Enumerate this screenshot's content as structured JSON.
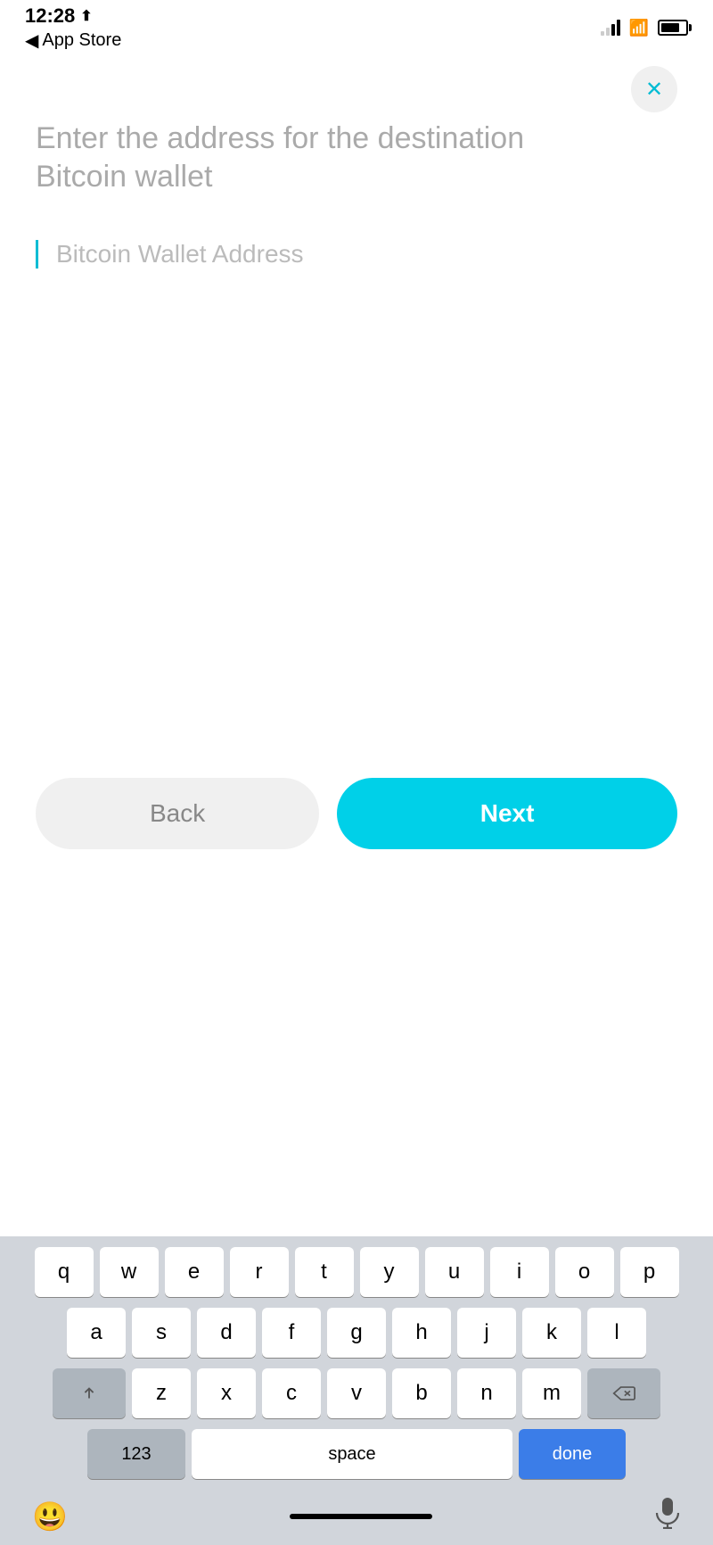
{
  "statusBar": {
    "time": "12:28",
    "appStoreBack": "App Store",
    "backArrow": "◀"
  },
  "closeButton": {
    "icon": "✕"
  },
  "page": {
    "title": "Enter the address for the destination Bitcoin wallet",
    "inputPlaceholder": "Bitcoin Wallet Address"
  },
  "buttons": {
    "back": "Back",
    "next": "Next"
  },
  "keyboard": {
    "row1": [
      "q",
      "w",
      "e",
      "r",
      "t",
      "y",
      "u",
      "i",
      "o",
      "p"
    ],
    "row2": [
      "a",
      "s",
      "d",
      "f",
      "g",
      "h",
      "j",
      "k",
      "l"
    ],
    "row3": [
      "z",
      "x",
      "c",
      "v",
      "b",
      "n",
      "m"
    ],
    "numberLabel": "123",
    "spaceLabel": "space",
    "doneLabel": "done"
  }
}
